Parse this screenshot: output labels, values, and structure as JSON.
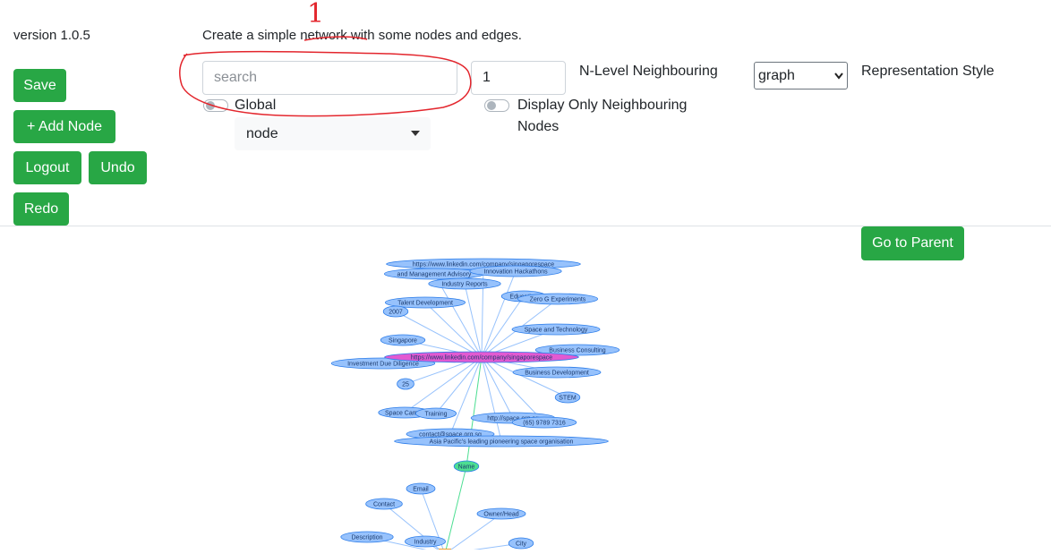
{
  "header": {
    "version": "version 1.0.5",
    "description": "Create a simple network with some nodes and edges."
  },
  "annotation": {
    "mark": "1",
    "color": "#e3262d"
  },
  "sidebar": {
    "save": "Save",
    "add_node": "+ Add Node",
    "logout": "Logout",
    "undo": "Undo",
    "redo": "Redo"
  },
  "search": {
    "placeholder": "search",
    "value": ""
  },
  "global_toggle": {
    "label": "Global",
    "on": false
  },
  "node_type_select": {
    "value": "node"
  },
  "level_input": {
    "value": "1"
  },
  "n_level_label": "N-Level Neighbouring",
  "neighbour_toggle": {
    "label_line1": "Display Only Neighbouring",
    "label_line2": "Nodes",
    "on": false
  },
  "representation": {
    "value": "graph",
    "label": "Representation Style"
  },
  "go_to_parent": "Go to Parent",
  "colors": {
    "accent": "#28a745",
    "node_fill": "#97c2fc",
    "node_stroke": "#2b7ce9",
    "edge": "#97c2fc",
    "hub": "#e25ad1",
    "name_node": "#4dde92"
  },
  "graph": {
    "hub_label": "https://www.linkedin.com/company/singaporespace",
    "upper_nodes": [
      "https://www.linkedin.com/company/singaporespace",
      "and Management Advisory",
      "Innovation Hackathons",
      "Industry Reports",
      "Education",
      "Zero G Experiments",
      "Talent Development",
      "2007",
      "Space and Technology",
      "Singapore",
      "Business Consulting",
      "Investment Due Diligence",
      "Business Development",
      "25",
      "STEM",
      "Space Camps",
      "Training",
      "http://space.org.sg",
      "(65) 9789 7316",
      "contact@space.org.sg",
      "Asia Pacific's leading pioneering space organisation"
    ],
    "name_node": "Name",
    "lower_nodes": [
      "Email",
      "Contact",
      "Owner/Head",
      "Description",
      "Industry",
      "City"
    ]
  }
}
